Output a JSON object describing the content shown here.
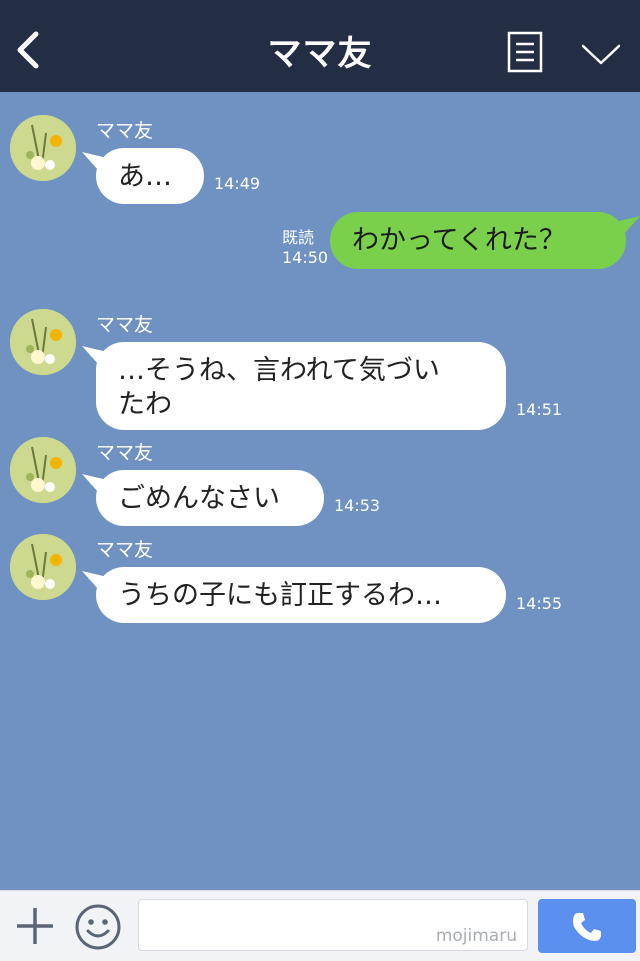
{
  "header": {
    "title": "ママ友",
    "back_icon": "chevron-left-icon",
    "menu_icon": "document-list-icon",
    "expand_icon": "chevron-down-icon"
  },
  "colors": {
    "header_bg": "#232d44",
    "chat_bg": "#6f92c2",
    "outgoing_bubble": "#7ad04a",
    "incoming_bubble": "#ffffff",
    "call_button": "#5b8ff0"
  },
  "messages": [
    {
      "sender": "ママ友",
      "text": "あ…",
      "time": "14:49"
    },
    {
      "read_label": "既読",
      "text": "わかってくれた？",
      "time": "14:50"
    },
    {
      "sender": "ママ友",
      "line1": "…そうね、言われて気づい",
      "line2": "たわ",
      "time": "14:51"
    },
    {
      "sender": "ママ友",
      "text": "ごめんなさい",
      "time": "14:53"
    },
    {
      "sender": "ママ友",
      "text": "うちの子にも訂正するわ…",
      "time": "14:55"
    }
  ],
  "bottom": {
    "watermark": "mojimaru",
    "plus_icon": "plus-icon",
    "emoji_icon": "smile-icon",
    "call_icon": "phone-icon"
  }
}
